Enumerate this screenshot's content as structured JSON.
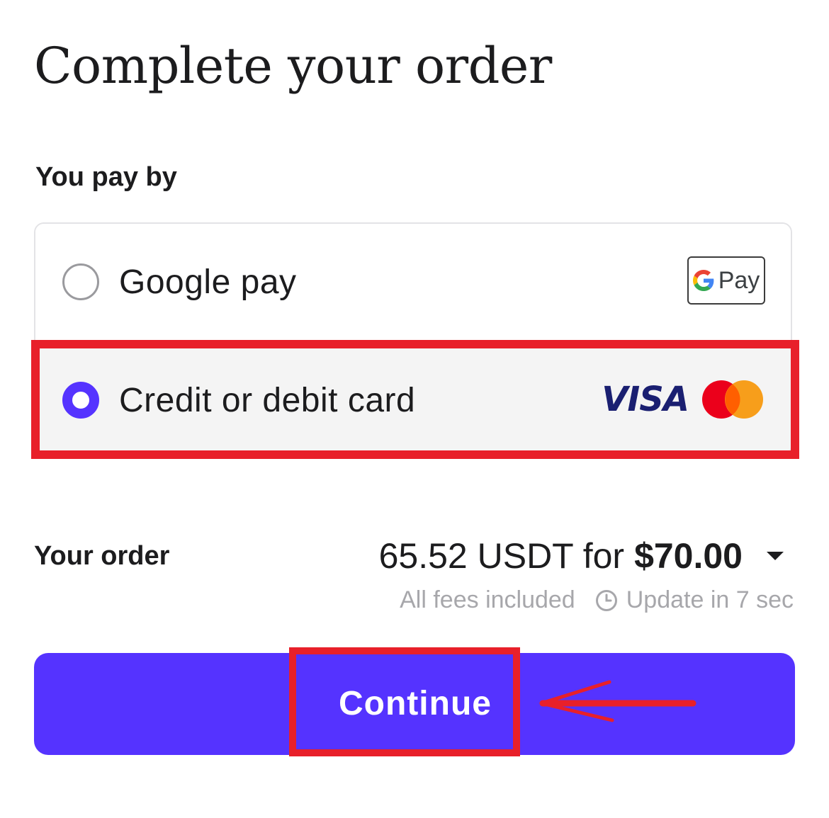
{
  "title": "Complete your order",
  "payment": {
    "label": "You pay by",
    "methods": [
      {
        "label": "Google pay",
        "selected": false,
        "badge_text": "Pay",
        "icon": "google-pay-icon"
      },
      {
        "label": "Credit or debit card",
        "selected": true,
        "brand_text": "VISA",
        "icons": [
          "visa-icon",
          "mastercard-icon"
        ]
      }
    ]
  },
  "order": {
    "label": "Your order",
    "crypto_amount": "65.52 USDT for",
    "fiat_amount": "$70.00",
    "fees_note": "All fees included",
    "update_note": "Update in 7 sec"
  },
  "continue_label": "Continue",
  "colors": {
    "accent": "#5533ff",
    "annotation": "#e8202a",
    "visa": "#1a1f71",
    "mastercard_red": "#eb001b",
    "mastercard_yellow": "#f79e1b"
  }
}
